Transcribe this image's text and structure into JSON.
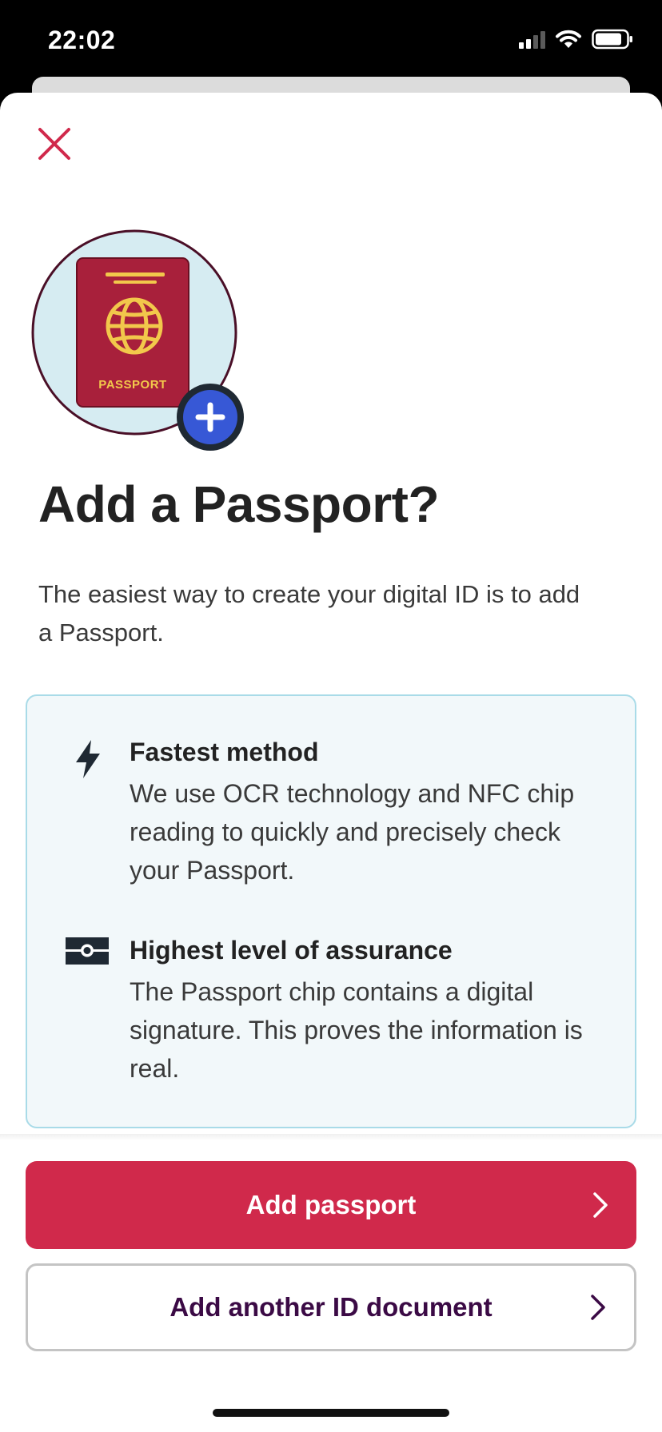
{
  "status_bar": {
    "time": "22:02"
  },
  "sheet": {
    "close_icon": "close-icon",
    "hero": {
      "passport_label": "PASSPORT",
      "badge_icon": "plus-icon"
    },
    "title": "Add a Passport?",
    "intro": "The easiest way to create your digital ID is to add a Passport.",
    "features": [
      {
        "icon": "lightning-icon",
        "title": "Fastest method",
        "description": "We use OCR technology and NFC chip reading to quickly and precisely check your Passport."
      },
      {
        "icon": "chip-icon",
        "title": "Highest level of assurance",
        "description": "The Passport chip contains a digital signature. This proves the information is real."
      }
    ]
  },
  "actions": {
    "primary_label": "Add passport",
    "secondary_label": "Add another ID document"
  },
  "colors": {
    "accent": "#d0294b",
    "secondary_text": "#3b0a45",
    "info_bg": "#f2f8fa",
    "info_border": "#a9dbe8",
    "badge": "#3758d6",
    "passport_cover": "#a8203b",
    "passport_gold": "#f2c84b"
  }
}
